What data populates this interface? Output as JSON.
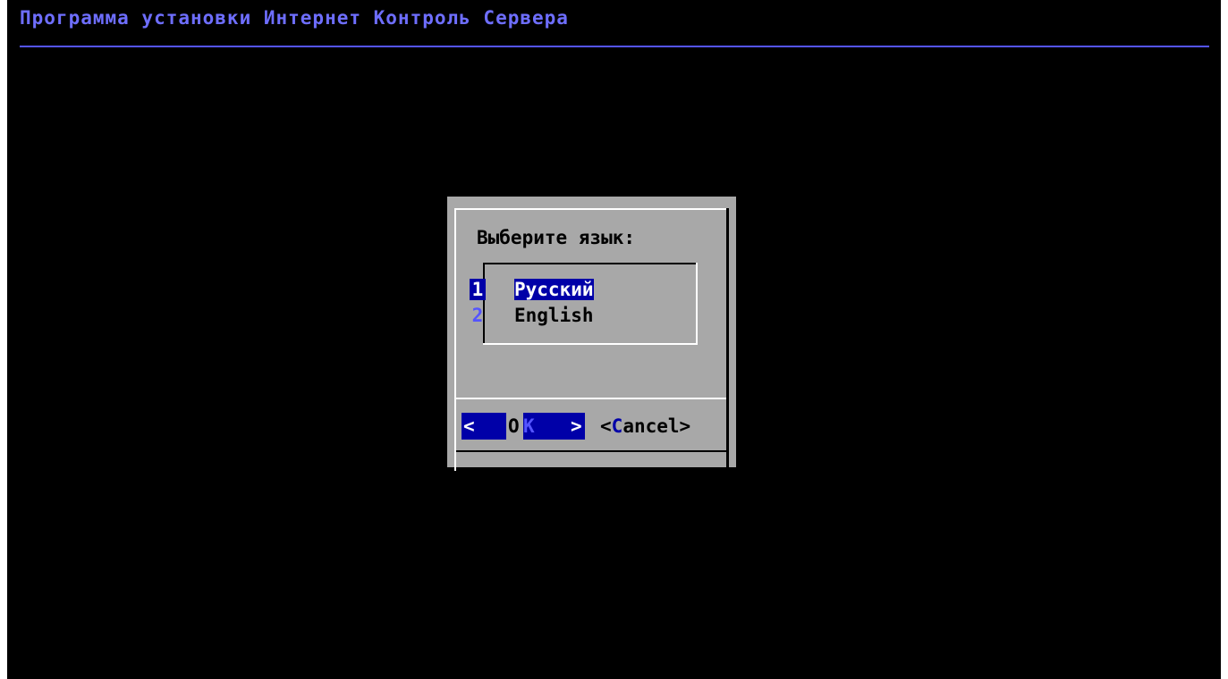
{
  "backtitle": "Программа установки Интернет Контроль Сервера",
  "dialog": {
    "prompt": "Выберите язык:",
    "items": [
      {
        "tag": "1",
        "label": "Русский",
        "selected": true
      },
      {
        "tag": "2",
        "label": "English",
        "selected": false
      }
    ],
    "ok_button": {
      "left": "<",
      "first": "O",
      "hotkey": "K",
      "right": ">"
    },
    "cancel_button": {
      "left": "<",
      "hotkey": "C",
      "rest": "ancel",
      "right": ">"
    }
  },
  "colors": {
    "screen_bg": "#000000",
    "title_fg": "#6e6eff",
    "dialog_bg": "#a8a8a8",
    "highlight_bg": "#0000a8",
    "highlight_fg": "#ffffff",
    "tag_fg": "#5454ff"
  }
}
